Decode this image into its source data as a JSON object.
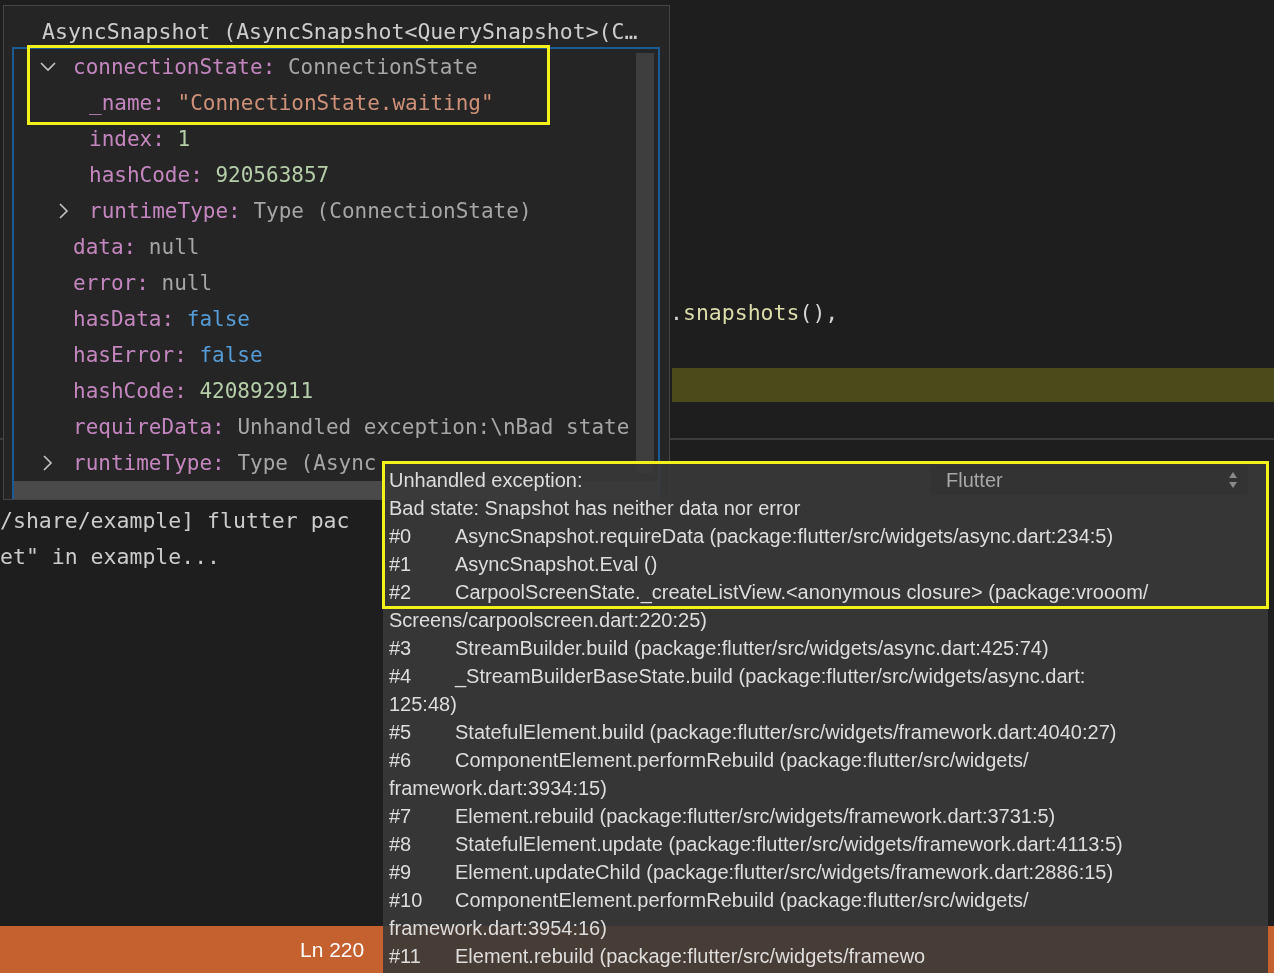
{
  "editor": {
    "code_tokens": [
      {
        "text": ".",
        "kind": "punct"
      },
      {
        "text": "snapshots",
        "kind": "method"
      },
      {
        "text": "(),",
        "kind": "punct"
      }
    ]
  },
  "debug_hover": {
    "title": "AsyncSnapshot (AsyncSnapshot<QuerySnapshot>(C…",
    "tree": [
      {
        "key": "connectionState:",
        "value": "ConnectionState",
        "kind": "type",
        "expanded": true,
        "children": [
          {
            "key": "_name:",
            "value": "\"ConnectionState.waiting\"",
            "kind": "string"
          },
          {
            "key": "index:",
            "value": "1",
            "kind": "number"
          },
          {
            "key": "hashCode:",
            "value": "920563857",
            "kind": "number"
          },
          {
            "key": "runtimeType:",
            "value": "Type (ConnectionState)",
            "kind": "type",
            "expanded": false
          }
        ]
      },
      {
        "key": "data:",
        "value": "null",
        "kind": "type"
      },
      {
        "key": "error:",
        "value": "null",
        "kind": "type"
      },
      {
        "key": "hasData:",
        "value": "false",
        "kind": "keyword"
      },
      {
        "key": "hasError:",
        "value": "false",
        "kind": "keyword"
      },
      {
        "key": "hashCode:",
        "value": "420892911",
        "kind": "number"
      },
      {
        "key": "requireData:",
        "value": "Unhandled exception:\\nBad state",
        "kind": "type"
      },
      {
        "key": "runtimeType:",
        "value": "Type (Async",
        "kind": "type",
        "expanded": false
      }
    ]
  },
  "terminal": {
    "dropdown": {
      "label": "Flutter"
    },
    "lines": [
      "/share/example] flutter pac",
      "et\" in example..."
    ]
  },
  "status_bar": {
    "items": [
      "Ln 220"
    ]
  },
  "exception_tooltip": {
    "lines": [
      "Unhandled exception:",
      "Bad state: Snapshot has neither data nor error"
    ],
    "frames": [
      {
        "index": "#0",
        "lines": [
          "AsyncSnapshot.requireData (package:flutter/src/widgets/async.dart:234:5)"
        ]
      },
      {
        "index": "#1",
        "lines": [
          "AsyncSnapshot.Eval ()"
        ]
      },
      {
        "index": "#2",
        "lines": [
          "CarpoolScreenState._createListView.<anonymous closure> (package:vrooom/",
          "Screens/carpoolscreen.dart:220:25)"
        ]
      },
      {
        "index": "#3",
        "lines": [
          "StreamBuilder.build (package:flutter/src/widgets/async.dart:425:74)"
        ]
      },
      {
        "index": "#4",
        "lines": [
          "_StreamBuilderBaseState.build (package:flutter/src/widgets/async.dart:",
          "125:48)"
        ]
      },
      {
        "index": "#5",
        "lines": [
          "StatefulElement.build (package:flutter/src/widgets/framework.dart:4040:27)"
        ]
      },
      {
        "index": "#6",
        "lines": [
          "ComponentElement.performRebuild (package:flutter/src/widgets/",
          "framework.dart:3934:15)"
        ]
      },
      {
        "index": "#7",
        "lines": [
          "Element.rebuild (package:flutter/src/widgets/framework.dart:3731:5)"
        ]
      },
      {
        "index": "#8",
        "lines": [
          "StatefulElement.update (package:flutter/src/widgets/framework.dart:4113:5)"
        ]
      },
      {
        "index": "#9",
        "lines": [
          "Element.updateChild (package:flutter/src/widgets/framework.dart:2886:15)"
        ]
      },
      {
        "index": "#10",
        "lines": [
          "ComponentElement.performRebuild (package:flutter/src/widgets/",
          "framework.dart:3954:16)"
        ]
      },
      {
        "index": "#11",
        "lines": [
          "Element.rebuild (package:flutter/src/widgets/framewo"
        ]
      }
    ]
  }
}
